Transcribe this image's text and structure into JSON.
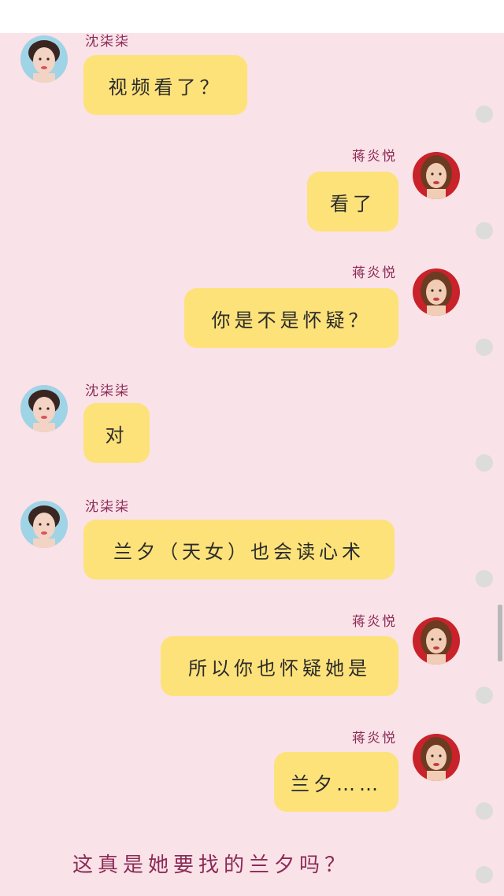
{
  "colors": {
    "background": "#f9e2e8",
    "bubble": "#fde27a",
    "name_text": "#8c2a55",
    "message_text": "#2b2b2b",
    "read_dot": "#dcdcdc"
  },
  "chat": {
    "messages": [
      {
        "side": "left",
        "sender": "沈柒柒",
        "avatar_icon": "avatar-icon-shen-qiqi",
        "text": "视频看了？"
      },
      {
        "side": "right",
        "sender": "蒋炎悦",
        "avatar_icon": "avatar-icon-jiang-yanyue",
        "text": "看了"
      },
      {
        "side": "right",
        "sender": "蒋炎悦",
        "avatar_icon": "avatar-icon-jiang-yanyue",
        "text": "你是不是怀疑？"
      },
      {
        "side": "left",
        "sender": "沈柒柒",
        "avatar_icon": "avatar-icon-shen-qiqi",
        "text": "对"
      },
      {
        "side": "left",
        "sender": "沈柒柒",
        "avatar_icon": "avatar-icon-shen-qiqi",
        "text": "兰夕（天女）也会读心术"
      },
      {
        "side": "right",
        "sender": "蒋炎悦",
        "avatar_icon": "avatar-icon-jiang-yanyue",
        "text": "所以你也怀疑她是"
      },
      {
        "side": "right",
        "sender": "蒋炎悦",
        "avatar_icon": "avatar-icon-jiang-yanyue",
        "text": "兰夕……"
      }
    ],
    "caption": "这真是她要找的兰夕吗？"
  }
}
